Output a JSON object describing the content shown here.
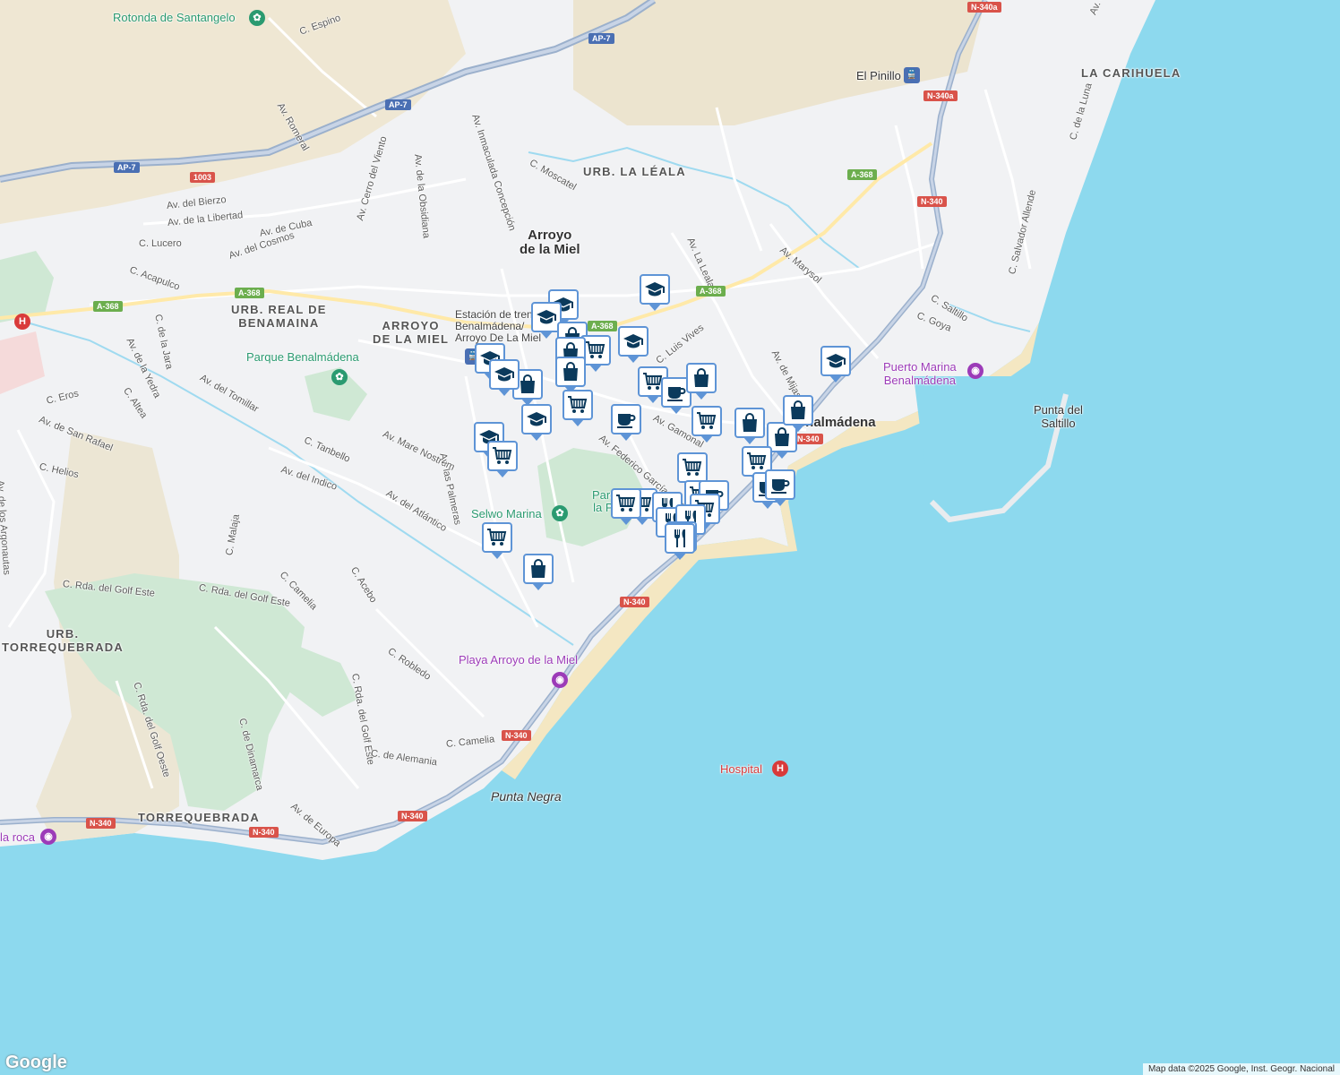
{
  "colors": {
    "sea": "#8dd9ee",
    "land": "#f1f2f4",
    "park": "#cfe8d4",
    "road": "#ffffff",
    "highway": "#9bb0cc",
    "marker_border": "#5e94d6",
    "marker_icon": "#0b3a5c"
  },
  "labels": {
    "rotonda": "Rotonda de Santangelo",
    "c_espino": "C. Espino",
    "av_romeral": "Av. Romeral",
    "av_bierzo": "Av. del Bierzo",
    "av_libertad": "Av. de la Libertad",
    "c_lucero": "C. Lucero",
    "av_cuba": "Av. de Cuba",
    "av_cosmos": "Av. del Cosmos",
    "c_acapulco": "C. Acapulco",
    "av_cerro": "Av. Cerro del Viento",
    "av_obsidiana": "Av. de la Obsidiana",
    "av_inmaculada": "Av. Inmaculada Concepción",
    "c_moscatel": "C. Moscatel",
    "urb_leala": "URB. LA LÉALA",
    "arroyo_city": "Arroyo\nde la Miel",
    "urb_real": "URB. REAL DE\nBENAMAINA",
    "arroyo_dist": "ARROYO\nDE LA MIEL",
    "estacion": "Estación de tren\nBenalmádena/\nArroyo De La Miel",
    "parque_benal": "Parque Benalmádena",
    "c_jara": "C. de la Jara",
    "av_yedra": "Av. de la Yedra",
    "c_altea": "C. Altea",
    "av_tomillar": "Av. del Tomillar",
    "c_eros": "C. Eros",
    "av_san_rafael": "Av. de San Rafael",
    "c_helios": "C. Helios",
    "av_argonautas": "Av. de los Argonautas",
    "c_tanbello": "C. Tanbello",
    "av_mare": "Av. Mare Nostrum",
    "av_palmeras": "Av. las Palmeras",
    "av_indico": "Av. del Indico",
    "av_atlantico": "Av. del Atlántico",
    "selwo": "Selwo Marina",
    "av_federico": "Av. Federico García Lorca",
    "parque_paloma": "Parque de la Paloma",
    "av_gamonal": "Av. Gamonal",
    "c_luis_vives": "C. Luis Vives",
    "av_la_leala": "Av. La Leala",
    "av_marysol": "Av. Marysol",
    "av_mijas": "Av. de Mijas",
    "el_pinillo": "El Pinillo",
    "la_carihuela": "LA CARIHUELA",
    "av_carlota": "Av. Carlota Alessandri",
    "c_luna": "C. de la Luna",
    "c_salvador": "C. Salvador Allende",
    "c_saltillo": "C. Saltillo",
    "c_goya": "C. Goya",
    "puerto": "Puerto Marina\nBenalmádena",
    "punta_saltillo": "Punta del\nSaltillo",
    "benalmadena": "Benalmádena",
    "urb_torre": "URB.\nTORREQUEBRADA",
    "c_malaja": "C. Malaja",
    "golf_este": "C. Rda. del Golf Este",
    "golf_este2": "C. Rda. del Golf Este",
    "c_camelia": "C. Camelia",
    "c_acebo": "C. Acebo",
    "c_robledo": "C. Robledo",
    "playa_arroyo": "Playa Arroyo de la Miel",
    "golf_oeste": "C. Rda. del Golf Oeste",
    "c_dinamarca": "C. de Dinamarca",
    "c_rda_golf_este3": "C. Rda. del Golf Este",
    "c_alemania": "C. de Alemania",
    "c_camelia2": "C. Camelia",
    "punta_negra": "Punta Negra",
    "hospital": "Hospital",
    "torrequebrada": "TORREQUEBRADA",
    "av_europa": "Av. de Europa",
    "la_roca": "la roca"
  },
  "shields": {
    "ap7_a": "AP-7",
    "ap7_b": "AP-7",
    "ap7_c": "AP-7",
    "r1003": "1003",
    "n340a_a": "N-340a",
    "n340a_b": "N-340a",
    "a368_a": "A-368",
    "a368_b": "A-368",
    "a368_c": "A-368",
    "a368_d": "A-368",
    "a368_e": "A-368",
    "n340_a": "N-340",
    "n340_b": "N-340",
    "n340_c": "N-340",
    "n340_d": "N-340",
    "n340_e": "N-340",
    "n340_f": "N-340",
    "n340_g": "N-340"
  },
  "markers": [
    {
      "icon": "school"
    },
    {
      "icon": "school"
    },
    {
      "icon": "school"
    },
    {
      "icon": "shopping-bag"
    },
    {
      "icon": "cart"
    },
    {
      "icon": "school"
    },
    {
      "icon": "school"
    },
    {
      "icon": "shopping-bag"
    },
    {
      "icon": "shopping-bag"
    },
    {
      "icon": "shopping-bag"
    },
    {
      "icon": "school"
    },
    {
      "icon": "cart"
    },
    {
      "icon": "school"
    },
    {
      "icon": "cart"
    },
    {
      "icon": "school"
    },
    {
      "icon": "cart"
    },
    {
      "icon": "coffee"
    },
    {
      "icon": "cart"
    },
    {
      "icon": "shopping-bag"
    },
    {
      "icon": "coffee"
    },
    {
      "icon": "cart"
    },
    {
      "icon": "shopping-bag"
    },
    {
      "icon": "shopping-bag"
    },
    {
      "icon": "shopping-bag"
    },
    {
      "icon": "cart"
    },
    {
      "icon": "cart"
    },
    {
      "icon": "cart"
    },
    {
      "icon": "coffee"
    },
    {
      "icon": "coffee"
    },
    {
      "icon": "coffee"
    },
    {
      "icon": "cart"
    },
    {
      "icon": "cart"
    },
    {
      "icon": "restaurant"
    },
    {
      "icon": "restaurant"
    },
    {
      "icon": "restaurant"
    },
    {
      "icon": "restaurant"
    },
    {
      "icon": "restaurant"
    },
    {
      "icon": "cart"
    },
    {
      "icon": "shopping-bag"
    },
    {
      "icon": "school"
    }
  ],
  "attribution": "Map data ©2025 Google, Inst. Geogr. Nacional",
  "google_logo": "Google"
}
